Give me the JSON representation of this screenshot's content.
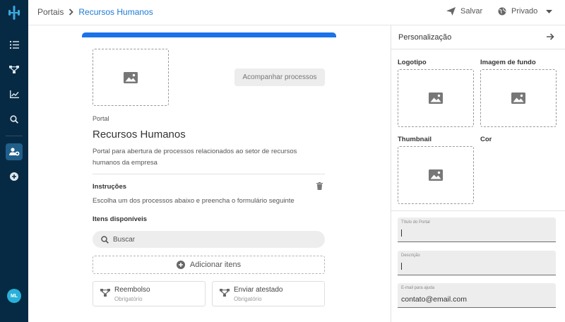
{
  "sidebar": {
    "avatar": "ML",
    "nav": [
      "tasks-icon",
      "flow-icon",
      "chart-icon",
      "search-icon",
      "portal-user-icon",
      "add-circle-icon"
    ]
  },
  "header": {
    "breadcrumb_root": "Portais",
    "breadcrumb_current": "Recursos Humanos",
    "save_label": "Salvar",
    "visibility_label": "Privado"
  },
  "main": {
    "follow_button": "Acompanhar processos",
    "type_label": "Portal",
    "title": "Recursos Humanos",
    "description": "Portal para abertura de processos relacionados ao setor de recursos humanos da empresa",
    "instructions_title": "Instruções",
    "instructions_text": "Escolha um dos processos abaixo e preencha o formulário seguinte",
    "available_items_title": "Itens disponíveis",
    "search_placeholder": "Buscar",
    "add_items_label": "Adicionar itens",
    "items": [
      {
        "name": "Reembolso",
        "status": "Obrigatório"
      },
      {
        "name": "Enviar atestado",
        "status": "Obrigatório"
      }
    ]
  },
  "panel": {
    "title": "Personalização",
    "logo_label": "Logotipo",
    "background_label": "Imagem de fundo",
    "thumbnail_label": "Thumbnail",
    "color_label": "Cor",
    "fields": [
      {
        "label": "Título do Portal",
        "value": ""
      },
      {
        "label": "Descrição",
        "value": ""
      },
      {
        "label": "E-mail para ajuda",
        "value": "contato@email.com"
      }
    ]
  },
  "colors": {
    "sidebar_bg": "#072a44",
    "accent": "#1a73e8",
    "breadcrumb_link": "#1c7ad6"
  }
}
